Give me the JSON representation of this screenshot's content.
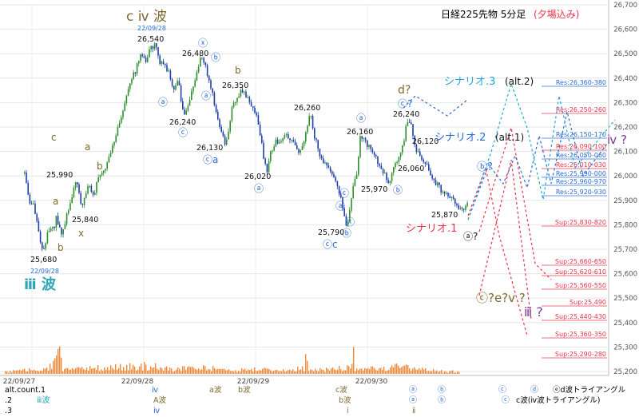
{
  "title": "日経225先物 5分足",
  "title_note": "(夕場込み)",
  "chart_data": {
    "type": "candlestick",
    "y_axis": {
      "min": 25200,
      "max": 26700,
      "step": 100,
      "ticks": [
        "26,700",
        "26,600",
        "26,500",
        "26,400",
        "26,300",
        "26,200",
        "26,100",
        "26,000",
        "25,900",
        "25,800",
        "25,700",
        "25,600",
        "25,500",
        "25,400",
        "25,300",
        "25,200"
      ]
    },
    "x_ticks": [
      "22/09/27",
      "22/09/28",
      "22/09/29",
      "22/09/30"
    ],
    "price_path": [
      [
        30,
        26010
      ],
      [
        36,
        25880
      ],
      [
        42,
        25880
      ],
      [
        48,
        25760
      ],
      [
        53,
        25690
      ],
      [
        58,
        25750
      ],
      [
        62,
        25800
      ],
      [
        66,
        25780
      ],
      [
        70,
        25830
      ],
      [
        76,
        25760
      ],
      [
        82,
        25830
      ],
      [
        88,
        25900
      ],
      [
        94,
        25990
      ],
      [
        98,
        25920
      ],
      [
        102,
        25880
      ],
      [
        106,
        25930
      ],
      [
        110,
        25960
      ],
      [
        116,
        25920
      ],
      [
        122,
        25990
      ],
      [
        128,
        26020
      ],
      [
        134,
        26060
      ],
      [
        140,
        26120
      ],
      [
        146,
        26180
      ],
      [
        152,
        26250
      ],
      [
        158,
        26330
      ],
      [
        164,
        26400
      ],
      [
        170,
        26440
      ],
      [
        176,
        26500
      ],
      [
        182,
        26470
      ],
      [
        188,
        26520
      ],
      [
        194,
        26540
      ],
      [
        198,
        26470
      ],
      [
        204,
        26450
      ],
      [
        210,
        26430
      ],
      [
        214,
        26380
      ],
      [
        218,
        26350
      ],
      [
        222,
        26410
      ],
      [
        226,
        26300
      ],
      [
        230,
        26240
      ],
      [
        234,
        26290
      ],
      [
        238,
        26330
      ],
      [
        242,
        26380
      ],
      [
        246,
        26420
      ],
      [
        250,
        26470
      ],
      [
        254,
        26480
      ],
      [
        258,
        26420
      ],
      [
        262,
        26380
      ],
      [
        266,
        26320
      ],
      [
        270,
        26260
      ],
      [
        274,
        26200
      ],
      [
        278,
        26160
      ],
      [
        282,
        26130
      ],
      [
        286,
        26200
      ],
      [
        290,
        26280
      ],
      [
        296,
        26320
      ],
      [
        302,
        26350
      ],
      [
        308,
        26330
      ],
      [
        314,
        26290
      ],
      [
        320,
        26250
      ],
      [
        326,
        26150
      ],
      [
        330,
        26060
      ],
      [
        334,
        26020
      ],
      [
        338,
        26090
      ],
      [
        344,
        26140
      ],
      [
        350,
        26150
      ],
      [
        356,
        26180
      ],
      [
        362,
        26160
      ],
      [
        368,
        26120
      ],
      [
        374,
        26090
      ],
      [
        378,
        26120
      ],
      [
        384,
        26200
      ],
      [
        388,
        26260
      ],
      [
        392,
        26180
      ],
      [
        398,
        26100
      ],
      [
        404,
        26060
      ],
      [
        410,
        26050
      ],
      [
        416,
        26000
      ],
      [
        422,
        25950
      ],
      [
        426,
        25910
      ],
      [
        430,
        25840
      ],
      [
        434,
        25790
      ],
      [
        438,
        25870
      ],
      [
        442,
        25960
      ],
      [
        446,
        26000
      ],
      [
        450,
        26160
      ],
      [
        456,
        26140
      ],
      [
        462,
        26120
      ],
      [
        468,
        26080
      ],
      [
        474,
        26050
      ],
      [
        480,
        26010
      ],
      [
        486,
        25970
      ],
      [
        492,
        26040
      ],
      [
        498,
        26060
      ],
      [
        504,
        26130
      ],
      [
        510,
        26240
      ],
      [
        514,
        26200
      ],
      [
        518,
        26120
      ],
      [
        524,
        26090
      ],
      [
        530,
        26060
      ],
      [
        536,
        26020
      ],
      [
        542,
        25980
      ],
      [
        548,
        25960
      ],
      [
        554,
        25930
      ],
      [
        560,
        25920
      ],
      [
        566,
        25900
      ],
      [
        572,
        25880
      ],
      [
        578,
        25870
      ],
      [
        584,
        25880
      ]
    ],
    "volume_path": [
      [
        10,
        3
      ],
      [
        40,
        5
      ],
      [
        60,
        7
      ],
      [
        75,
        28
      ],
      [
        78,
        5
      ],
      [
        100,
        6
      ],
      [
        130,
        8
      ],
      [
        180,
        10
      ],
      [
        195,
        9
      ],
      [
        210,
        6
      ],
      [
        240,
        8
      ],
      [
        280,
        6
      ],
      [
        300,
        5
      ],
      [
        320,
        6
      ],
      [
        350,
        5
      ],
      [
        380,
        7
      ],
      [
        383,
        22
      ],
      [
        386,
        5
      ],
      [
        420,
        6
      ],
      [
        440,
        10
      ],
      [
        441,
        48
      ],
      [
        444,
        5
      ],
      [
        470,
        7
      ],
      [
        500,
        9
      ],
      [
        530,
        5
      ],
      [
        560,
        3
      ]
    ],
    "resistance_levels": [
      {
        "label": "Res:26,360-380",
        "color": "#2a6bd1"
      },
      {
        "label": "Res:26,250-260",
        "color": "#e8334a"
      },
      {
        "label": "Res:26,150-170",
        "color": "#2a6bd1"
      },
      {
        "label": "Res:26,090-100",
        "color": "#e8334a"
      },
      {
        "label": "Res:26,050-060",
        "color": "#2a6bd1"
      },
      {
        "label": "Res:26,010-030",
        "color": "#e8334a"
      },
      {
        "label": "Res:25,990-000",
        "color": "#2a6bd1"
      },
      {
        "label": "Res:25,960-970",
        "color": "#2a6bd1"
      },
      {
        "label": "Res:25,920-930",
        "color": "#2a6bd1"
      }
    ],
    "support_levels": [
      {
        "label": "Sup:25,830-820",
        "color": "#e8334a"
      },
      {
        "label": "Sup:25,660-650",
        "color": "#e8334a"
      },
      {
        "label": "Sup:25,620-610",
        "color": "#e8334a"
      },
      {
        "label": "Sup:25,560-550",
        "color": "#e8334a"
      },
      {
        "label": "Sup:25,490",
        "color": "#e8334a"
      },
      {
        "label": "Sup:25,440-430",
        "color": "#e8334a"
      },
      {
        "label": "Sup:25,360-350",
        "color": "#e8334a"
      },
      {
        "label": "Sup:25,290-280",
        "color": "#e8334a"
      }
    ],
    "scenarios": [
      {
        "name": "シナリオ.3",
        "note": "(alt.2)",
        "color": "#22a5d8"
      },
      {
        "name": "シナリオ.2",
        "note": "(alt.1)",
        "color": "#2a6bd1"
      },
      {
        "name": "シナリオ.1",
        "note": "",
        "color": "#e8334a"
      }
    ],
    "price_labels": [
      "26,540",
      "26,480",
      "26,350",
      "26,260",
      "26,240",
      "26,160",
      "26,240",
      "26,130",
      "26,120",
      "26,060",
      "26,020",
      "25,990",
      "25,970",
      "25,870",
      "25,840",
      "25,790",
      "25,680"
    ],
    "wave_labels": {
      "iv_wave": "c ⅳ 波",
      "iii_wave": "ⅲ 波",
      "date_top": "22/09/28",
      "date_bottom": "22/09/28",
      "d_q": "d?",
      "c_q": "ⓒ?",
      "a_q": "ⓐ?",
      "b_q": "ⓑ?",
      "c_e_v": "ⓒ?e?ⅴ ?",
      "iii_q": "ⅲ ?",
      "iv_q": "ⅳ ?",
      "x": "ⓧ",
      "b": "ⓑ",
      "a": "ⓐ",
      "c": "ⓒ",
      "ca": "ⓒa",
      "ax": "ⓐ",
      "bx": "ⓑ",
      "cc": "ⓒc",
      "small_a": "a",
      "small_b": "b",
      "small_c": "c",
      "small_x": "x"
    },
    "legend": {
      "rows": [
        [
          "alt.count.1",
          "",
          "ⅳ",
          "a波",
          "b波",
          "",
          "",
          "c波",
          "",
          "ⓐ",
          "ⓑ",
          "",
          "ⓒ",
          "ⓓ",
          "ⓔd波トライアングル"
        ],
        [
          ".2",
          "ⅲ波",
          "",
          "A波",
          "",
          "",
          "",
          "b波",
          "",
          "ⓐ",
          "ⓑ",
          "",
          "ⓒ",
          "c波(ⅳ波トライアングル)"
        ],
        [
          ".3",
          "",
          "ⅳ",
          "",
          "",
          "",
          "",
          "ⅰ",
          "",
          "ⅱ",
          "",
          "",
          "",
          ""
        ]
      ],
      "row1": {
        "a": "alt.count.1",
        "b": "ⅳ",
        "c": "a波",
        "d": "b波",
        "e": "c波",
        "f": "ⓐ",
        "g": "ⓑ",
        "h": "ⓒ",
        "i": "ⓓ",
        "j": "ⓔd波トライアングル"
      },
      "row2": {
        "a": ".2",
        "b": "ⅲ波",
        "c": "A波",
        "d": "b波",
        "e": "ⓐ",
        "f": "ⓑ",
        "g": "ⓒ",
        "h": "c波(ⅳ波トライアングル)"
      },
      "row3": {
        "a": ".3",
        "b": "ⅳ",
        "c": "ⅰ",
        "d": "ⅱ"
      }
    }
  }
}
